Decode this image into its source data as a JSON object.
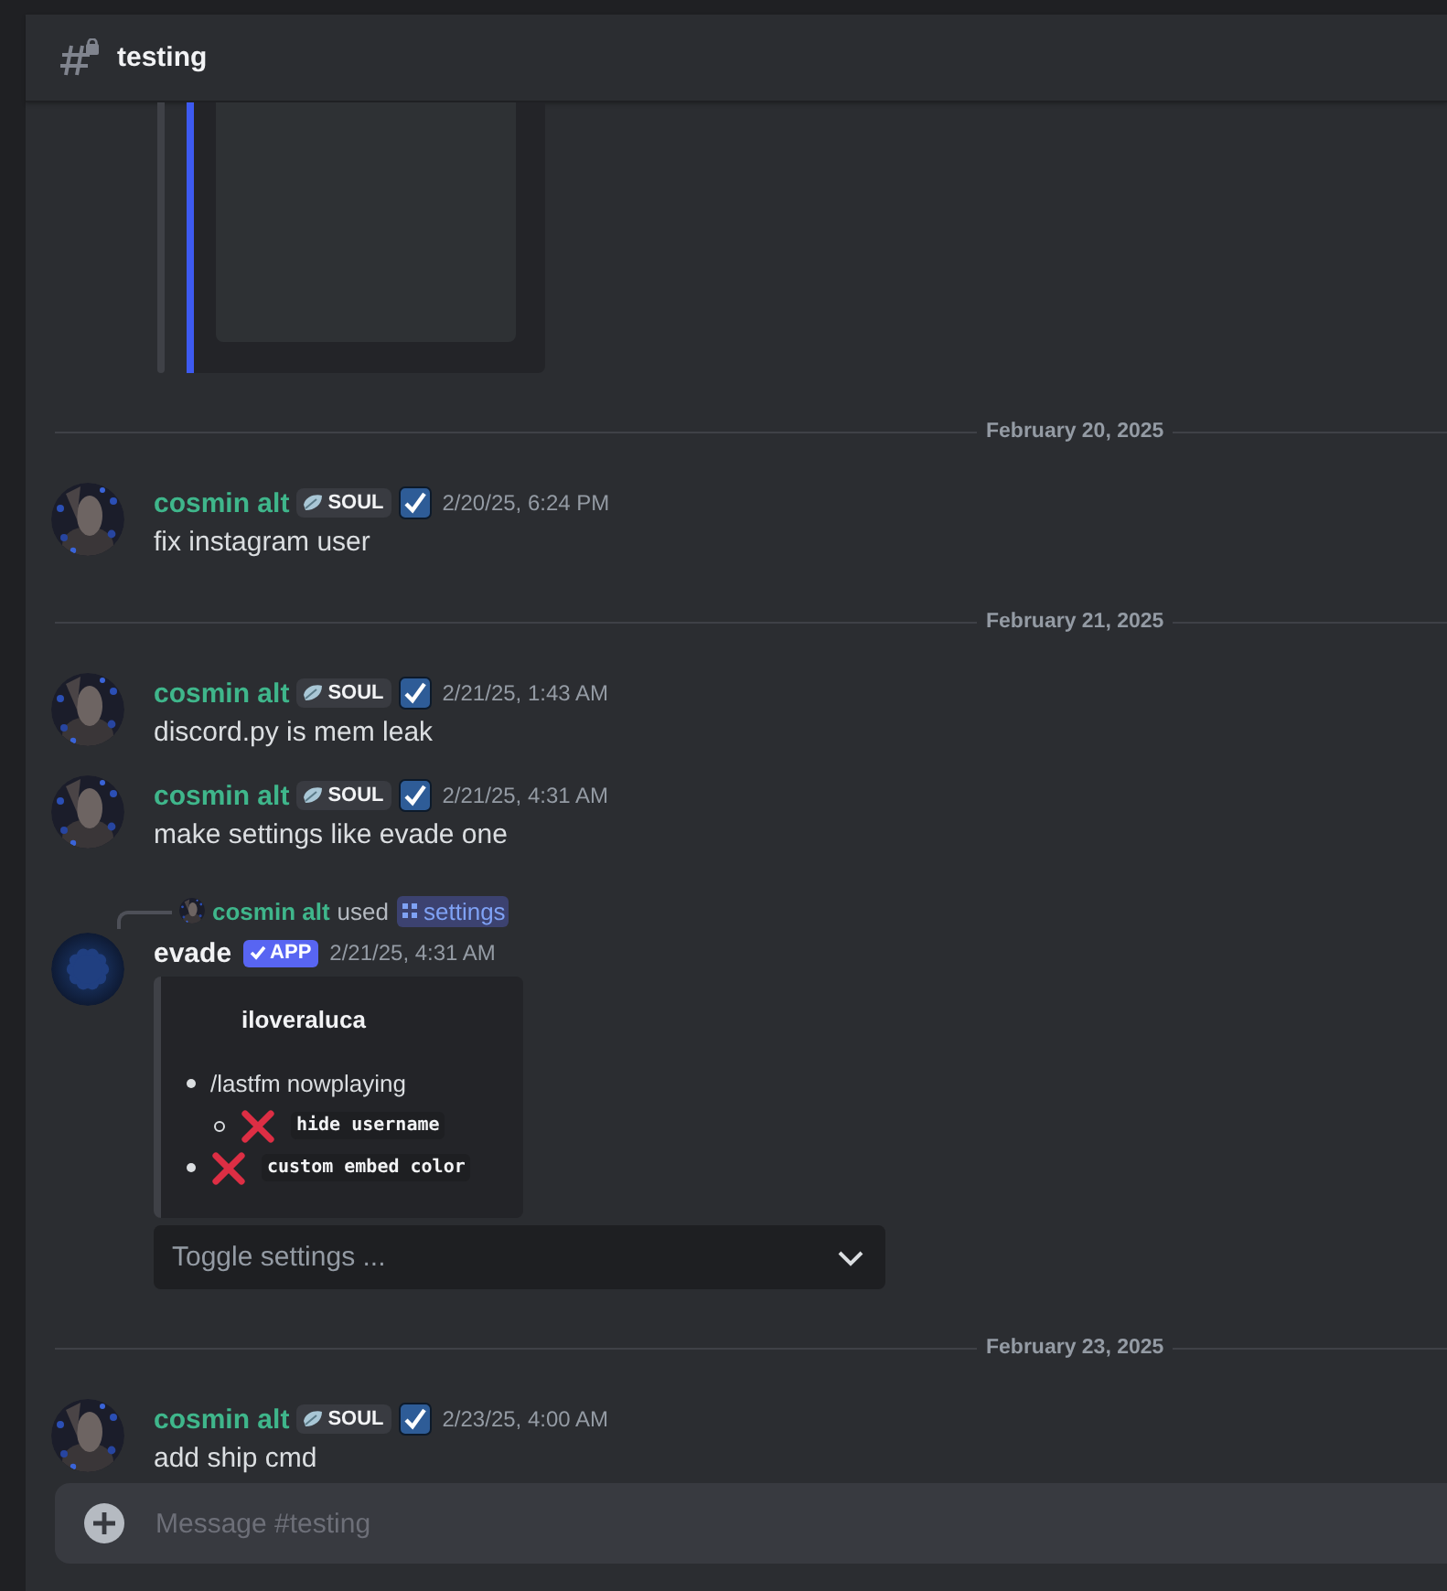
{
  "channel": {
    "name": "testing",
    "locked": true
  },
  "feed": [
    {
      "kind": "image_embed"
    },
    {
      "kind": "divider",
      "label": "February 20, 2025"
    },
    {
      "kind": "message",
      "author": "cosmin alt",
      "color": "#3fb68b",
      "tag": "SOUL",
      "verified": true,
      "time": "2/20/25, 6:24 PM",
      "text": "fix instagram user"
    },
    {
      "kind": "divider",
      "label": "February 21, 2025"
    },
    {
      "kind": "message",
      "author": "cosmin alt",
      "color": "#3fb68b",
      "tag": "SOUL",
      "verified": true,
      "time": "2/21/25, 1:43 AM",
      "text": "discord.py is mem leak"
    },
    {
      "kind": "message",
      "author": "cosmin alt",
      "color": "#3fb68b",
      "tag": "SOUL",
      "verified": true,
      "time": "2/21/25, 4:31 AM",
      "text": "make settings like evade one"
    },
    {
      "kind": "app_message",
      "reply": {
        "author": "cosmin alt",
        "color": "#3fb68b",
        "verb": "used",
        "command": "settings"
      },
      "author": "evade",
      "badge": "APP",
      "time": "2/21/25, 4:31 AM",
      "embed": {
        "title": "iloveraluca",
        "items": [
          {
            "kind": "text",
            "text": "/lastfm nowplaying",
            "children": [
              {
                "kind": "option",
                "enabled": false,
                "code": "hide username"
              }
            ]
          },
          {
            "kind": "option",
            "enabled": false,
            "code": "custom embed color"
          }
        ]
      },
      "select": {
        "placeholder": "Toggle settings ..."
      }
    },
    {
      "kind": "divider",
      "label": "February 23, 2025"
    },
    {
      "kind": "message",
      "author": "cosmin alt",
      "color": "#3fb68b",
      "tag": "SOUL",
      "verified": true,
      "time": "2/23/25, 4:00 AM",
      "text": "add ship cmd"
    }
  ],
  "composer": {
    "placeholder": "Message #testing"
  }
}
